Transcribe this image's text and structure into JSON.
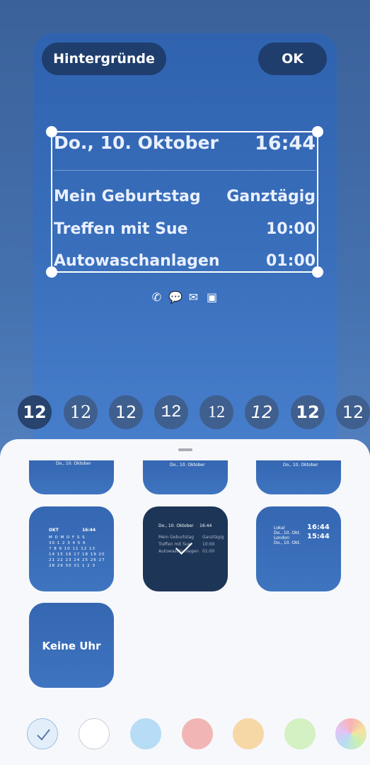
{
  "header": {
    "backgrounds_label": "Hintergründe",
    "ok_label": "OK"
  },
  "widget": {
    "date": "Do., 10. Oktober",
    "time": "16:44",
    "events": [
      {
        "name": "Mein Geburtstag",
        "time": "Ganztägig"
      },
      {
        "name": "Treffen mit Sue",
        "time": "10:00"
      },
      {
        "name": "Autowaschanlagen",
        "time": "01:00"
      }
    ]
  },
  "notification_icons": [
    "missed-call-icon",
    "chat-icon",
    "mail-icon",
    "file-icon"
  ],
  "clock_styles": [
    "12",
    "12",
    "12",
    "12",
    "12",
    "12",
    "12",
    "12"
  ],
  "tiles": {
    "top_date": "Do., 10. Oktober",
    "calendar": {
      "month": "OKT",
      "time": "16:44",
      "weekdays": "M D M D F S S",
      "rows": [
        "30 1 2 3 4 5 6",
        "7 8 9 10 11 12 13",
        "14 15 16 17 18 19 20",
        "21 22 23 24 25 26 27",
        "28 29 30 31 1 2 3"
      ]
    },
    "agenda": {
      "date": "Do., 10. Oktober",
      "time": "16:44",
      "e1": "Mein Geburtstag",
      "e1t": "Ganztägig",
      "e2": "Treffen mit Sue",
      "e2t": "10:00",
      "e3": "Autowaschanlagen",
      "e3t": "01:00"
    },
    "dual": {
      "city1": "Lokal",
      "date1": "Do., 10. Okt.",
      "time1": "16:44",
      "city2": "London",
      "date2": "Do., 10. Okt.",
      "time2": "15:44"
    },
    "none_label": "Keine Uhr"
  },
  "colors": {
    "swatches": [
      "#e3eefb",
      "#ffffff",
      "#b7dcf5",
      "#f2b5b5",
      "#f6d7a6",
      "#d3f1c2"
    ]
  }
}
